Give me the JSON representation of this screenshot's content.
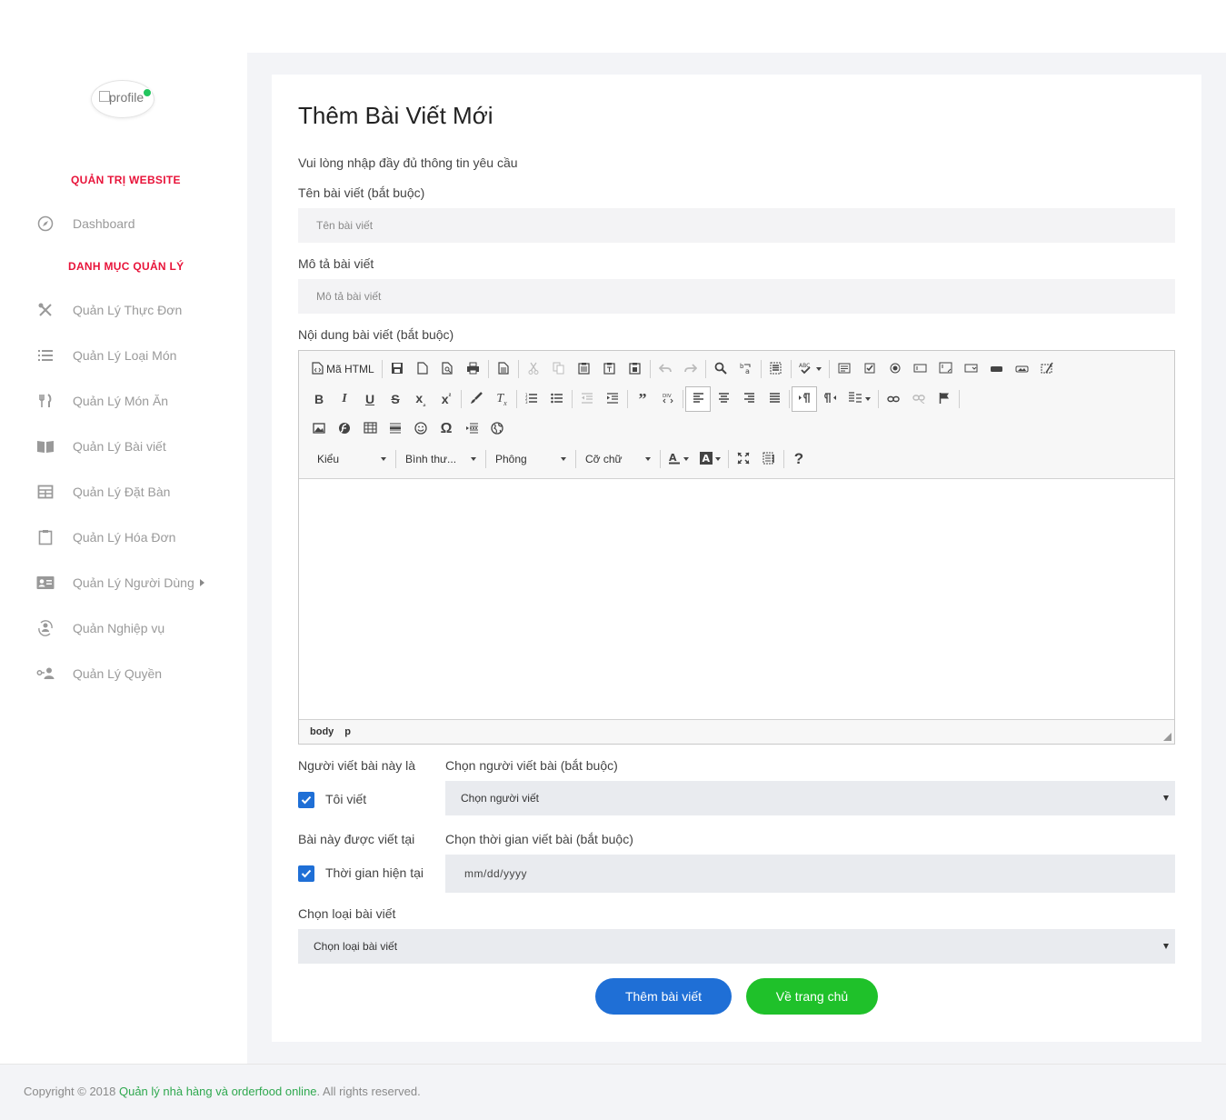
{
  "sidebar": {
    "profile_alt": "profile",
    "section_admin": "QUẢN TRỊ WEBSITE",
    "dashboard": "Dashboard",
    "section_manage": "DANH MỤC QUẢN LÝ",
    "items": [
      {
        "label": "Quản Lý Thực Đơn",
        "icon": "utensils-icon"
      },
      {
        "label": "Quản Lý Loại Món",
        "icon": "list-icon"
      },
      {
        "label": "Quản Lý Món Ăn",
        "icon": "fork-knife-icon"
      },
      {
        "label": "Quản Lý Bài viết",
        "icon": "book-icon"
      },
      {
        "label": "Quản Lý Đặt Bàn",
        "icon": "table-icon"
      },
      {
        "label": "Quản Lý Hóa Đơn",
        "icon": "clipboard-icon"
      },
      {
        "label": "Quản Lý Người Dùng",
        "icon": "id-card-icon"
      },
      {
        "label": "Quản Nghiệp vụ",
        "icon": "user-cycle-icon"
      },
      {
        "label": "Quản Lý Quyền",
        "icon": "user-key-icon"
      }
    ]
  },
  "form": {
    "title": "Thêm Bài Viết Mới",
    "subtitle": "Vui lòng nhập đầy đủ thông tin yêu cầu",
    "name_label": "Tên bài viết (bắt buộc)",
    "name_placeholder": "Tên bài viết",
    "desc_label": "Mô tả bài viết",
    "desc_placeholder": "Mô tả bài viết",
    "content_label": "Nội dung bài viết (bắt buộc)",
    "author_label": "Người viết bài này là",
    "author_check": "Tôi viết",
    "author_select_label": "Chọn người viết bài (bắt buộc)",
    "author_select_value": "Chọn người viết",
    "written_label": "Bài này được viết tại",
    "written_check": "Thời gian hiện tại",
    "time_select_label": "Chọn thời gian viết bài (bắt buộc)",
    "time_placeholder": "mm/dd/yyyy",
    "type_label": "Chọn loại bài viết",
    "type_select_value": "Chọn loại bài viết",
    "submit_button": "Thêm bài viết",
    "home_button": "Về trang chủ"
  },
  "editor": {
    "source_label": "Mã HTML",
    "style_combo": "Kiểu",
    "format_combo": "Bình thư...",
    "font_combo": "Phông",
    "size_combo": "Cỡ chữ",
    "path": [
      "body",
      "p"
    ]
  },
  "footer": {
    "prefix": "Copyright © 2018 ",
    "link": "Quản lý nhà hàng và orderfood online",
    "suffix": ". All rights reserved."
  },
  "colors": {
    "accent_red": "#e8143a",
    "primary_blue": "#1f6fd6",
    "success_green": "#1fc12a"
  }
}
